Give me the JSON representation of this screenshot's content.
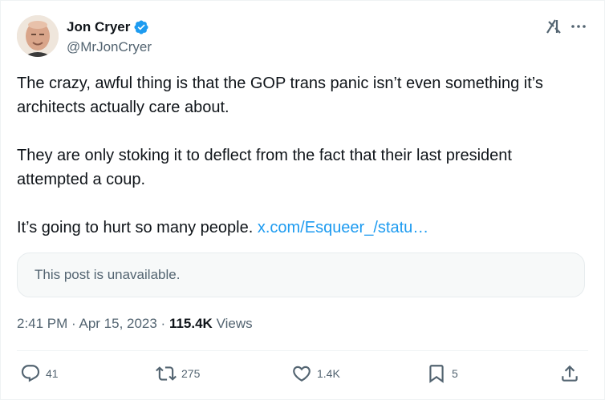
{
  "author": {
    "display_name": "Jon Cryer",
    "handle": "@MrJonCryer"
  },
  "tweet": {
    "paragraphs": [
      "The crazy, awful thing is that the GOP trans panic isn’t even something it’s architects actually care about.",
      "They are only stoking it to deflect from the fact that their last president attempted a coup."
    ],
    "last_paragraph_text": "It’s going to hurt so many people. ",
    "link_text": "x.com/Esqueer_/statu…"
  },
  "quote_card": {
    "text": "This post is unavailable."
  },
  "meta": {
    "timestamp": "2:41 PM · Apr 15, 2023 · ",
    "views_count": "115.4K",
    "views_label": " Views"
  },
  "actions": {
    "replies": "41",
    "reposts": "275",
    "likes": "1.4K",
    "bookmarks": "5"
  },
  "colors": {
    "link": "#1d9bf0",
    "verified": "#1d9bf0",
    "secondary_text": "#536471"
  },
  "icons": [
    "verified-badge-icon",
    "grok-icon",
    "more-icon",
    "reply-icon",
    "repost-icon",
    "like-icon",
    "bookmark-icon",
    "share-icon"
  ]
}
